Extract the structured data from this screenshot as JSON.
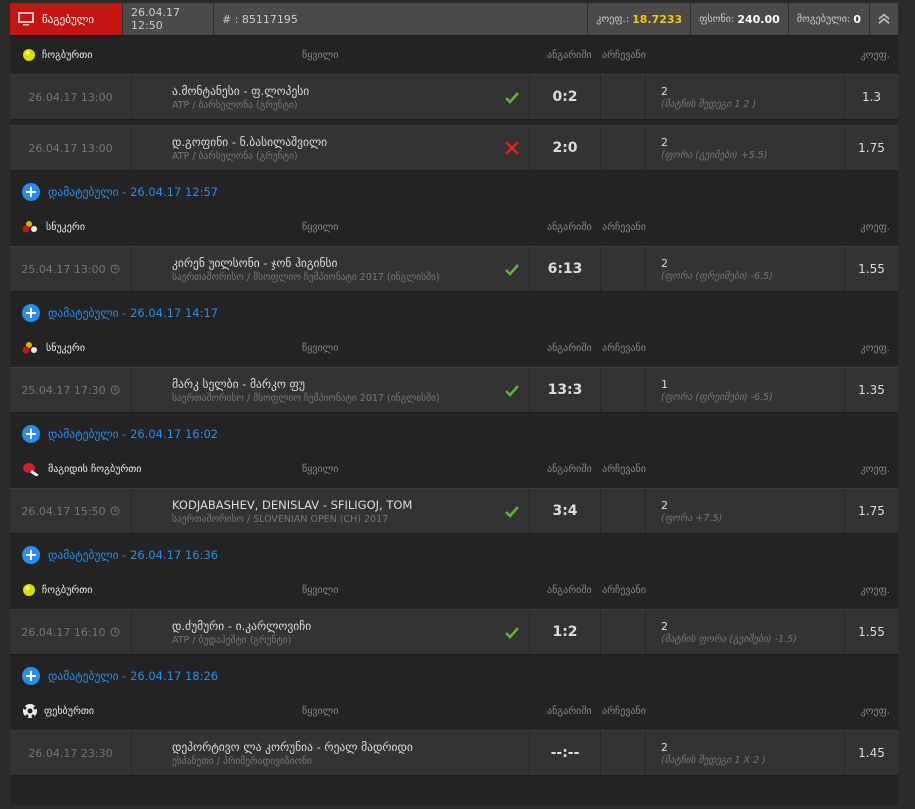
{
  "header": {
    "status": "წაგებული",
    "date": "26.04.17 12:50",
    "ticket": "# : 85117195",
    "odds_label": "კოეფ.:",
    "odds_value": "18.7233",
    "stake_label": "ფსონი:",
    "stake_value": "240.00",
    "won_label": "მოგებული:",
    "won_value": "0"
  },
  "columns": {
    "pair": "წყვილი",
    "score": "ანგარიში",
    "choice": "არჩევანი",
    "odds": "კოეფ."
  },
  "colors": {
    "lost": "#c41414",
    "accent": "#2a8ee8",
    "win": "#5fb336",
    "loss": "#e02020",
    "odds": "#f5c518"
  },
  "sections": [
    {
      "added": null,
      "sport": "ჩოგბურთი",
      "icon": "tennis-ball",
      "bets": [
        {
          "date": "26.04.17 13:00",
          "clock": false,
          "match": "ა.მონტანესი - ფ.ლოპესი",
          "league": "ATP / ბარსელონა (გრუნტი)",
          "result": "win",
          "score": "0:2",
          "pick": "2",
          "market": "(მატჩის შედეგი 1 2 )",
          "odds": "1.3"
        },
        {
          "date": "26.04.17 13:00",
          "clock": false,
          "match": "დ.გოფინი - ნ.ბასილაშვილი",
          "league": "ATP / ბარსელონა (გრუნტი)",
          "result": "loss",
          "score": "2:0",
          "pick": "2",
          "market": "(ფორა (გეიმები) +5.5)",
          "odds": "1.75"
        }
      ]
    },
    {
      "added": "დამატებული - 26.04.17 12:57",
      "sport": "სნუკერი",
      "icon": "snooker-balls",
      "bets": [
        {
          "date": "25.04.17 13:00",
          "clock": true,
          "match": "კირენ უილსონი - ჯონ ჰიგინსი",
          "league": "საერთაშორისო / მსოფლიო ჩემპიონატი 2017 (ინგლისში)",
          "result": "win",
          "score": "6:13",
          "pick": "2",
          "market": "(ფორა (ფრეიმები) -6.5)",
          "odds": "1.55"
        }
      ]
    },
    {
      "added": "დამატებული - 26.04.17 14:17",
      "sport": "სნუკერი",
      "icon": "snooker-balls",
      "bets": [
        {
          "date": "25.04.17 17:30",
          "clock": true,
          "match": "მარკ სელბი - მარკო ფუ",
          "league": "საერთაშორისო / მსოფლიო ჩემპიონატი 2017 (ინგლისში)",
          "result": "win",
          "score": "13:3",
          "pick": "1",
          "market": "(ფორა (ფრეიმები) -6.5)",
          "odds": "1.35"
        }
      ]
    },
    {
      "added": "დამატებული - 26.04.17 16:02",
      "sport": "მაგიდის ჩოგბურთი",
      "icon": "table-tennis",
      "bets": [
        {
          "date": "26.04.17 15:50",
          "clock": true,
          "match": "KODJABASHEV, DENISLAV - SFILIGOJ, TOM",
          "league": "საერთაშორისო / SLOVENIAN OPEN (CH) 2017",
          "result": "win",
          "score": "3:4",
          "pick": "2",
          "market": "(ფორა +7.5)",
          "odds": "1.75"
        }
      ]
    },
    {
      "added": "დამატებული - 26.04.17 16:36",
      "sport": "ჩოგბურთი",
      "icon": "tennis-ball",
      "bets": [
        {
          "date": "26.04.17 16:10",
          "clock": true,
          "match": "დ.ძუმური - ი.კარლოვიჩი",
          "league": "ATP / ბუდაპეშტი (გრუნტი)",
          "result": "win",
          "score": "1:2",
          "pick": "2",
          "market": "(მატჩის ფორა (გეიმები) -1.5)",
          "odds": "1.55"
        }
      ]
    },
    {
      "added": "დამატებული - 26.04.17 18:26",
      "sport": "ფეხბურთი",
      "icon": "soccer-ball",
      "bets": [
        {
          "date": "26.04.17 23:30",
          "clock": false,
          "match": "დეპორტივო ლა კორუნია - რეალ მადრიდი",
          "league": "ესპანეთი / პრიმერადივიზიონი",
          "result": "none",
          "score": "--:--",
          "pick": "2",
          "market": "(მატჩის შედეგი 1 X 2 )",
          "odds": "1.45"
        }
      ]
    }
  ]
}
